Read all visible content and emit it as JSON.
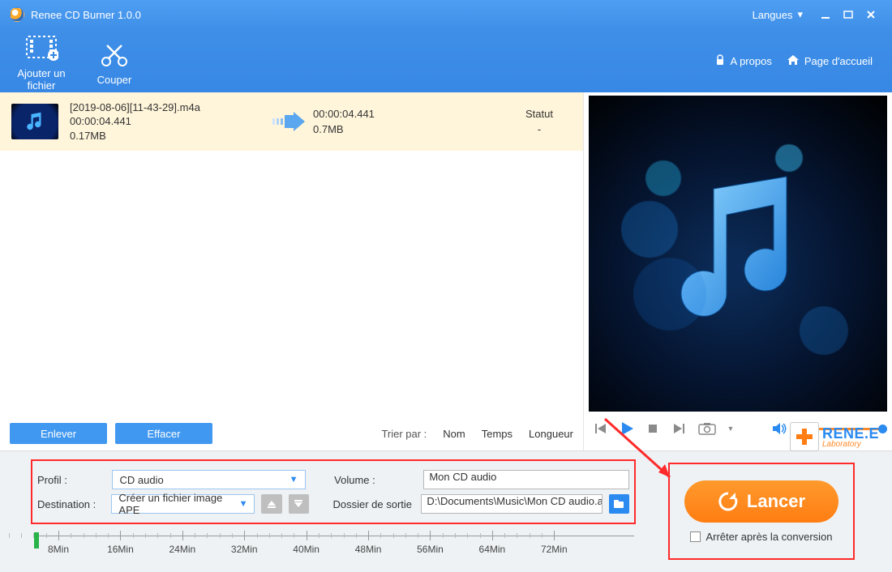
{
  "titlebar": {
    "title": "Renee CD Burner 1.0.0",
    "lang": "Langues"
  },
  "toolbar": {
    "add_file": "Ajouter un fichier",
    "cut": "Couper",
    "about": "A propos",
    "home": "Page d'accueil"
  },
  "file": {
    "name": "[2019-08-06][11-43-29].m4a",
    "duration": "00:00:04.441",
    "size": "0.17MB",
    "out_duration": "00:00:04.441",
    "out_size": "0.7MB",
    "status_label": "Statut",
    "status_value": "-"
  },
  "listbar": {
    "remove": "Enlever",
    "clear": "Effacer",
    "sort_by": "Trier par :",
    "name": "Nom",
    "time": "Temps",
    "length": "Longueur"
  },
  "settings": {
    "profile_label": "Profil :",
    "profile_value": "CD audio",
    "volume_label": "Volume :",
    "volume_value": "Mon CD audio",
    "dest_label": "Destination :",
    "dest_value": "Créer un fichier image APE",
    "folder_label": "Dossier de sortie",
    "folder_value": "D:\\Documents\\Music\\Mon CD audio.ap"
  },
  "ruler": {
    "ticks": [
      "8Min",
      "16Min",
      "24Min",
      "32Min",
      "40Min",
      "48Min",
      "56Min",
      "64Min",
      "72Min"
    ]
  },
  "launch": {
    "button": "Lancer",
    "stop_after": "Arrêter après la conversion"
  },
  "brand": {
    "name": "RENE.E",
    "sub": "Laboratory"
  }
}
